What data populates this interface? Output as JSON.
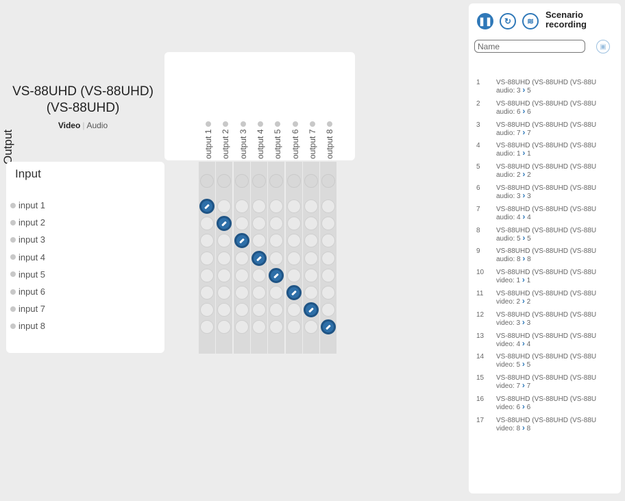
{
  "device": {
    "title_line1": "VS-88UHD (VS-88UHD)",
    "title_line2": "(VS-88UHD)",
    "tab_video": "Video",
    "tab_audio": "Audio"
  },
  "output": {
    "title": "Output",
    "labels": [
      "output 1",
      "output 2",
      "output 3",
      "output 4",
      "output 5",
      "output 6",
      "output 7",
      "output 8"
    ]
  },
  "input": {
    "title": "Input",
    "labels": [
      "input 1",
      "input 2",
      "input 3",
      "input 4",
      "input 5",
      "input 6",
      "input 7",
      "input 8"
    ]
  },
  "matrix": {
    "connections": [
      [
        1,
        1
      ],
      [
        2,
        2
      ],
      [
        3,
        3
      ],
      [
        4,
        4
      ],
      [
        5,
        5
      ],
      [
        6,
        6
      ],
      [
        7,
        7
      ],
      [
        8,
        8
      ]
    ]
  },
  "scenario": {
    "label_line1": "Scenario",
    "label_line2": "recording",
    "name_placeholder": "Name",
    "pause_icon": "pause-icon",
    "refresh_icon": "refresh-icon",
    "layers_icon": "layers-icon",
    "save_icon": "save-icon",
    "accent_color": "#2f78b8"
  },
  "recordings": [
    {
      "num": "1",
      "text": "VS-88UHD (VS-88UHD (VS-88U",
      "type": "audio:",
      "from": "3",
      "to": "5"
    },
    {
      "num": "2",
      "text": "VS-88UHD (VS-88UHD (VS-88U",
      "type": "audio:",
      "from": "6",
      "to": "6"
    },
    {
      "num": "3",
      "text": "VS-88UHD (VS-88UHD (VS-88U",
      "type": "audio:",
      "from": "7",
      "to": "7"
    },
    {
      "num": "4",
      "text": "VS-88UHD (VS-88UHD (VS-88U",
      "type": "audio:",
      "from": "1",
      "to": "1"
    },
    {
      "num": "5",
      "text": "VS-88UHD (VS-88UHD (VS-88U",
      "type": "audio:",
      "from": "2",
      "to": "2"
    },
    {
      "num": "6",
      "text": "VS-88UHD (VS-88UHD (VS-88U",
      "type": "audio:",
      "from": "3",
      "to": "3"
    },
    {
      "num": "7",
      "text": "VS-88UHD (VS-88UHD (VS-88U",
      "type": "audio:",
      "from": "4",
      "to": "4"
    },
    {
      "num": "8",
      "text": "VS-88UHD (VS-88UHD (VS-88U",
      "type": "audio:",
      "from": "5",
      "to": "5"
    },
    {
      "num": "9",
      "text": "VS-88UHD (VS-88UHD (VS-88U",
      "type": "audio:",
      "from": "8",
      "to": "8"
    },
    {
      "num": "10",
      "text": "VS-88UHD (VS-88UHD (VS-88U",
      "type": "video:",
      "from": "1",
      "to": "1"
    },
    {
      "num": "11",
      "text": "VS-88UHD (VS-88UHD (VS-88U",
      "type": "video:",
      "from": "2",
      "to": "2"
    },
    {
      "num": "12",
      "text": "VS-88UHD (VS-88UHD (VS-88U",
      "type": "video:",
      "from": "3",
      "to": "3"
    },
    {
      "num": "13",
      "text": "VS-88UHD (VS-88UHD (VS-88U",
      "type": "video:",
      "from": "4",
      "to": "4"
    },
    {
      "num": "14",
      "text": "VS-88UHD (VS-88UHD (VS-88U",
      "type": "video:",
      "from": "5",
      "to": "5"
    },
    {
      "num": "15",
      "text": "VS-88UHD (VS-88UHD (VS-88U",
      "type": "video:",
      "from": "7",
      "to": "7"
    },
    {
      "num": "16",
      "text": "VS-88UHD (VS-88UHD (VS-88U",
      "type": "video:",
      "from": "6",
      "to": "6"
    },
    {
      "num": "17",
      "text": "VS-88UHD (VS-88UHD (VS-88U",
      "type": "video:",
      "from": "8",
      "to": "8"
    }
  ]
}
